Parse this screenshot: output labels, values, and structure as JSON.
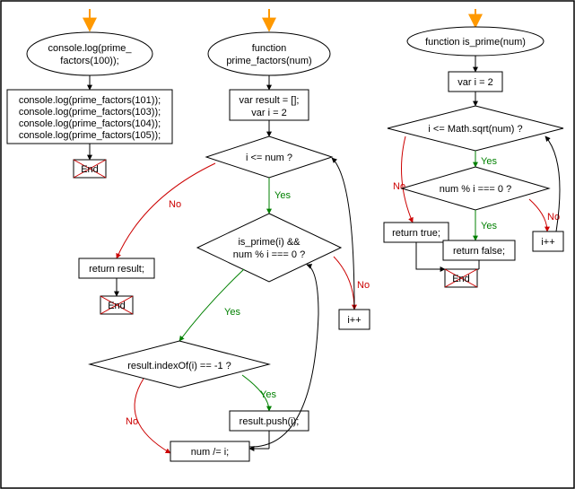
{
  "chart_data": {
    "type": "flowchart",
    "flows": [
      {
        "name": "driver",
        "nodes": {
          "start": {
            "type": "entry-arrow"
          },
          "call1": {
            "type": "terminator-ellipse",
            "text": "console.log(prime_\nfactors(100));"
          },
          "calls": {
            "type": "process",
            "text": "console.log(prime_factors(101));\nconsole.log(prime_factors(103));\nconsole.log(prime_factors(104));\nconsole.log(prime_factors(105));"
          },
          "end": {
            "type": "terminator-end",
            "text": "End"
          }
        },
        "edges": [
          {
            "from": "start",
            "to": "call1"
          },
          {
            "from": "call1",
            "to": "calls"
          },
          {
            "from": "calls",
            "to": "end"
          }
        ]
      },
      {
        "name": "prime_factors",
        "nodes": {
          "start": {
            "type": "entry-arrow"
          },
          "fn": {
            "type": "terminator-ellipse",
            "text": "function\nprime_factors(num)"
          },
          "init": {
            "type": "process",
            "text": "var result = [];\nvar i = 2"
          },
          "loop": {
            "type": "decision",
            "text": "i <= num ?"
          },
          "ret": {
            "type": "process",
            "text": "return result;"
          },
          "end1": {
            "type": "terminator-end",
            "text": "End"
          },
          "check": {
            "type": "decision",
            "text": "is_prime(i) &&\nnum % i === 0 ?"
          },
          "inc": {
            "type": "process",
            "text": "i++"
          },
          "idx": {
            "type": "decision",
            "text": "result.indexOf(i) == -1 ?"
          },
          "push": {
            "type": "process",
            "text": "result.push(i);"
          },
          "div": {
            "type": "process",
            "text": "num /= i;"
          }
        },
        "edges": [
          {
            "from": "start",
            "to": "fn"
          },
          {
            "from": "fn",
            "to": "init"
          },
          {
            "from": "init",
            "to": "loop"
          },
          {
            "from": "loop",
            "to": "ret",
            "label": "No"
          },
          {
            "from": "loop",
            "to": "check",
            "label": "Yes"
          },
          {
            "from": "ret",
            "to": "end1"
          },
          {
            "from": "check",
            "to": "inc",
            "label": "No"
          },
          {
            "from": "inc",
            "to": "loop",
            "label": ""
          },
          {
            "from": "check",
            "to": "idx",
            "label": "Yes"
          },
          {
            "from": "idx",
            "to": "push",
            "label": "Yes"
          },
          {
            "from": "idx",
            "to": "div",
            "label": "No"
          },
          {
            "from": "push",
            "to": "div"
          },
          {
            "from": "div",
            "to": "check"
          }
        ]
      },
      {
        "name": "is_prime",
        "nodes": {
          "start": {
            "type": "entry-arrow"
          },
          "fn": {
            "type": "terminator-ellipse",
            "text": "function is_prime(num)"
          },
          "init": {
            "type": "process",
            "text": "var i = 2"
          },
          "loop": {
            "type": "decision",
            "text": "i <= Math.sqrt(num) ?"
          },
          "rettrue": {
            "type": "process",
            "text": "return true;"
          },
          "mod": {
            "type": "decision",
            "text": "num % i === 0 ?"
          },
          "retfalse": {
            "type": "process",
            "text": "return false;"
          },
          "inc": {
            "type": "process",
            "text": "i++"
          },
          "end": {
            "type": "terminator-end",
            "text": "End"
          }
        },
        "edges": [
          {
            "from": "start",
            "to": "fn"
          },
          {
            "from": "fn",
            "to": "init"
          },
          {
            "from": "init",
            "to": "loop"
          },
          {
            "from": "loop",
            "to": "rettrue",
            "label": "No"
          },
          {
            "from": "loop",
            "to": "mod",
            "label": "Yes"
          },
          {
            "from": "mod",
            "to": "retfalse",
            "label": "Yes"
          },
          {
            "from": "mod",
            "to": "inc",
            "label": "No"
          },
          {
            "from": "inc",
            "to": "loop"
          },
          {
            "from": "rettrue",
            "to": "end"
          },
          {
            "from": "retfalse",
            "to": "end"
          }
        ]
      }
    ]
  },
  "labels": {
    "yes": "Yes",
    "no": "No",
    "end": "End"
  },
  "nodes": {
    "driver_call1_l1": "console.log(prime_",
    "driver_call1_l2": "factors(100));",
    "driver_calls_l1": "console.log(prime_factors(101));",
    "driver_calls_l2": "console.log(prime_factors(103));",
    "driver_calls_l3": "console.log(prime_factors(104));",
    "driver_calls_l4": "console.log(prime_factors(105));",
    "pf_fn_l1": "function",
    "pf_fn_l2": "prime_factors(num)",
    "pf_init_l1": "var result = [];",
    "pf_init_l2": "var i = 2",
    "pf_loop": "i <= num ?",
    "pf_ret": "return result;",
    "pf_check_l1": "is_prime(i) &&",
    "pf_check_l2": "num % i === 0 ?",
    "pf_inc": "i++",
    "pf_idx": "result.indexOf(i) == -1 ?",
    "pf_push": "result.push(i);",
    "pf_div": "num /= i;",
    "ip_fn": "function is_prime(num)",
    "ip_init": "var i = 2",
    "ip_loop": "i <= Math.sqrt(num) ?",
    "ip_rettrue": "return true;",
    "ip_mod": "num % i === 0 ?",
    "ip_retfalse": "return false;",
    "ip_inc": "i++"
  }
}
